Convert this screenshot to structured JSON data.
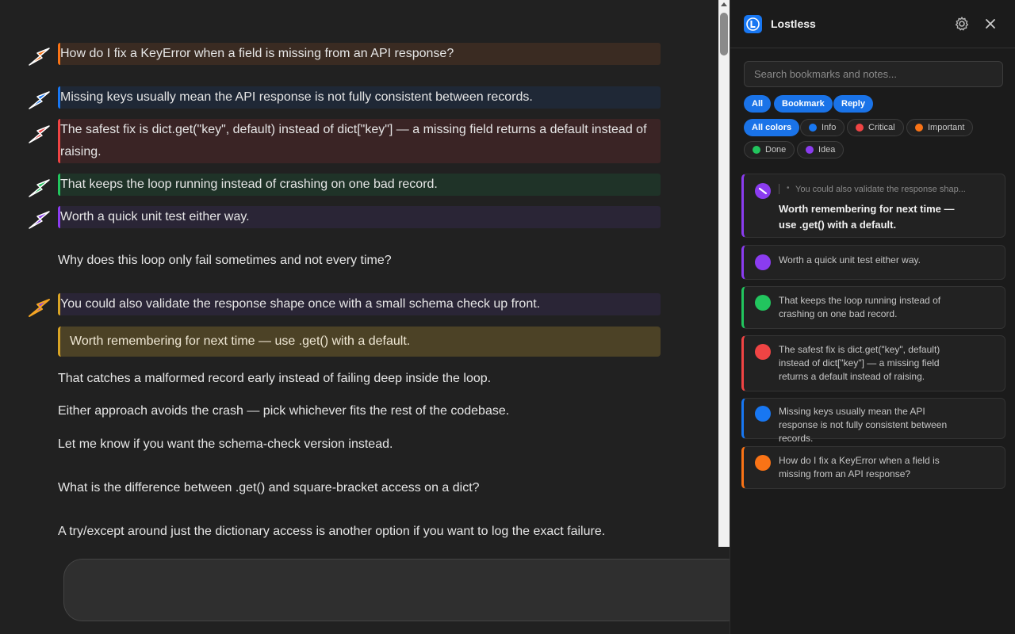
{
  "chat": {
    "highlights": [
      {
        "text": "How do I fix a KeyError when a field is missing from an API response?",
        "color": "#f97316",
        "bg": "#3a2b22"
      },
      {
        "text": "Missing keys usually mean the API response is not fully consistent between records.",
        "color": "#1877f2",
        "bg": "#1f2836"
      },
      {
        "text": "The safest fix is dict.get(\"key\", default) instead of dict[\"key\"] — a missing field returns a default instead of raising.",
        "color": "#ef4444",
        "bg": "#3a2425"
      },
      {
        "text": "That keeps the loop running instead of crashing on one bad record.",
        "color": "#22c55e",
        "bg": "#1f3328"
      },
      {
        "text": "Worth a quick unit test either way.",
        "color": "#8b3cf0",
        "bg": "#2a2536"
      },
      {
        "text": "You could also validate the response shape once with a small schema check up front.",
        "color": "#8b3cf0",
        "bg": "#2a2536"
      }
    ],
    "plain": [
      "Why does this loop only fail sometimes and not every time?",
      "That catches a malformed record early instead of failing deep inside the loop.",
      "Either approach avoids the crash — pick whichever fits the rest of the codebase.",
      "Let me know if you want the schema-check version instead.",
      "What is the difference between .get() and square-bracket access on a dict?",
      "A try/except around just the dictionary access is another option if you want to log the exact failure."
    ],
    "note": "Worth remembering for next time — use .get() with a default."
  },
  "panel": {
    "title": "Lostless",
    "search_placeholder": "Search bookmarks and notes...",
    "type_filters": [
      "All",
      "Bookmark",
      "Reply"
    ],
    "color_filters": [
      {
        "label": "All colors",
        "color": ""
      },
      {
        "label": "Info",
        "color": "#1877f2"
      },
      {
        "label": "Critical",
        "color": "#ef4444"
      },
      {
        "label": "Important",
        "color": "#f97316"
      },
      {
        "label": "Done",
        "color": "#22c55e"
      },
      {
        "label": "Idea",
        "color": "#8b3cf0"
      }
    ],
    "cards": [
      {
        "quote": "You could also validate the response shap...",
        "note": "Worth remembering for next time — use .get() with a default.",
        "color": "#8b3cf0"
      },
      {
        "text": "Worth a quick unit test either way.",
        "color": "#8b3cf0"
      },
      {
        "text": "That keeps the loop running instead of crashing on one bad record.",
        "color": "#22c55e"
      },
      {
        "text": "The safest fix is dict.get(\"key\", default) instead of dict[\"key\"] — a missing field returns a default instead of raising.",
        "color": "#ef4444"
      },
      {
        "text": "Missing keys usually mean the API response is not fully consistent between records.",
        "color": "#1877f2"
      },
      {
        "text": "How do I fix a KeyError when a field is missing from an API response?",
        "color": "#f97316"
      }
    ]
  }
}
